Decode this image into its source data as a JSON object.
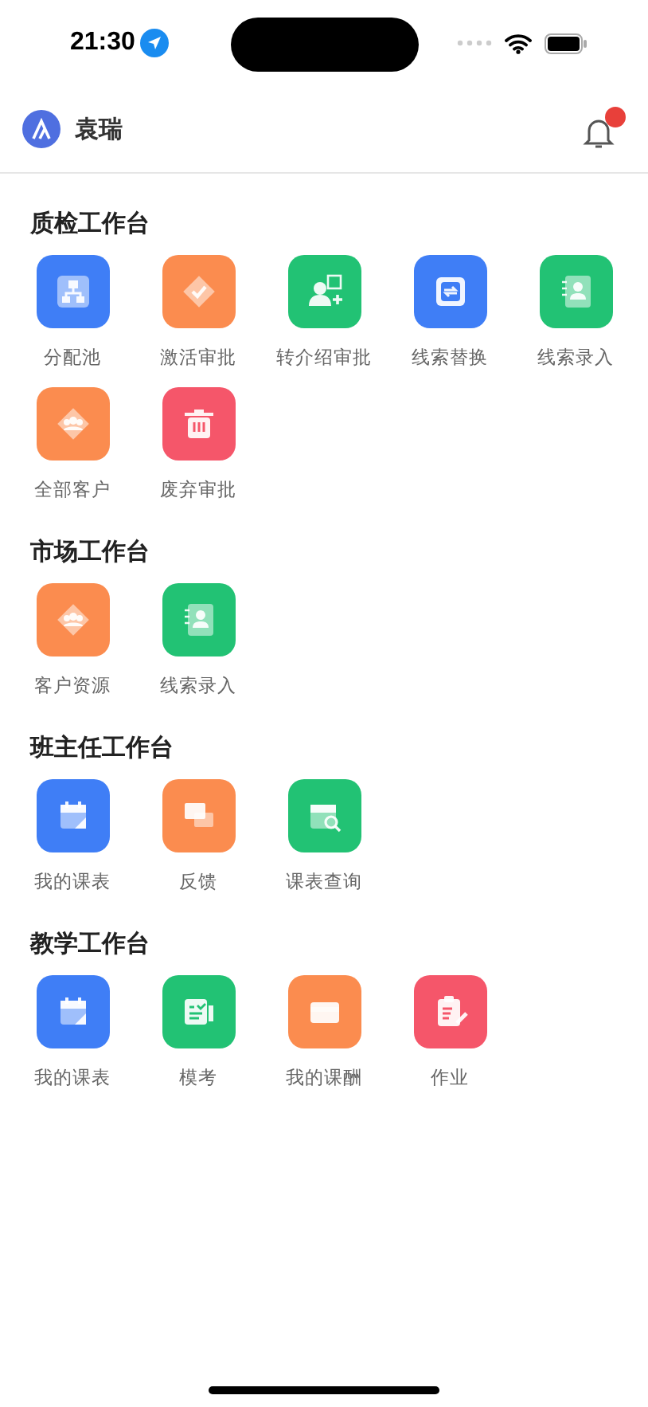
{
  "status_bar": {
    "time": "21:30"
  },
  "header": {
    "user_name": "袁瑞",
    "notification_badge": true
  },
  "sections": [
    {
      "title": "质检工作台",
      "items": [
        {
          "label": "分配池",
          "kind": "hierarchy",
          "color": "#3f7ef6"
        },
        {
          "label": "激活审批",
          "kind": "approve",
          "color": "#fb8c4f"
        },
        {
          "label": "转介绍审批",
          "kind": "referral",
          "color": "#22c274"
        },
        {
          "label": "线索替换",
          "kind": "swap",
          "color": "#3f7ef6"
        },
        {
          "label": "线索录入",
          "kind": "contacts",
          "color": "#22c274"
        },
        {
          "label": "全部客户",
          "kind": "group",
          "color": "#fb8c4f"
        },
        {
          "label": "废弃审批",
          "kind": "trash",
          "color": "#f5566a"
        }
      ]
    },
    {
      "title": "市场工作台",
      "items": [
        {
          "label": "客户资源",
          "kind": "group",
          "color": "#fb8c4f"
        },
        {
          "label": "线索录入",
          "kind": "contacts",
          "color": "#22c274"
        }
      ]
    },
    {
      "title": "班主任工作台",
      "items": [
        {
          "label": "我的课表",
          "kind": "calendar",
          "color": "#3f7ef6"
        },
        {
          "label": "反馈",
          "kind": "chat",
          "color": "#fb8c4f"
        },
        {
          "label": "课表查询",
          "kind": "lookup",
          "color": "#22c274"
        }
      ]
    },
    {
      "title": "教学工作台",
      "items": [
        {
          "label": "我的课表",
          "kind": "calendar",
          "color": "#3f7ef6"
        },
        {
          "label": "模考",
          "kind": "exam",
          "color": "#22c274"
        },
        {
          "label": "我的课酬",
          "kind": "wallet",
          "color": "#fb8c4f"
        },
        {
          "label": "作业",
          "kind": "clipboard",
          "color": "#f5566a"
        }
      ]
    }
  ]
}
